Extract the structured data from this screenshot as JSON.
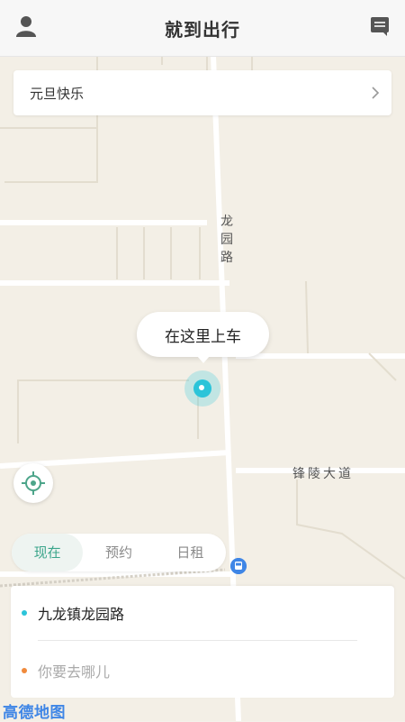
{
  "header": {
    "title": "就到出行",
    "user_icon": "user-icon",
    "message_icon": "message-icon"
  },
  "banner": {
    "text": "元旦快乐",
    "icon": "chevron-right-icon"
  },
  "map": {
    "street_longyuan": "龙园路",
    "street_fengling": "锋陵大道",
    "pickup_bubble": "在这里上车",
    "logo": "高德地图"
  },
  "tabs": [
    {
      "label": "现在",
      "active": true
    },
    {
      "label": "预约",
      "active": false
    },
    {
      "label": "日租",
      "active": false
    }
  ],
  "route": {
    "from_text": "九龙镇龙园路",
    "to_placeholder": "你要去哪儿",
    "from_color": "#2bc4d9",
    "to_color": "#f08a3c"
  }
}
